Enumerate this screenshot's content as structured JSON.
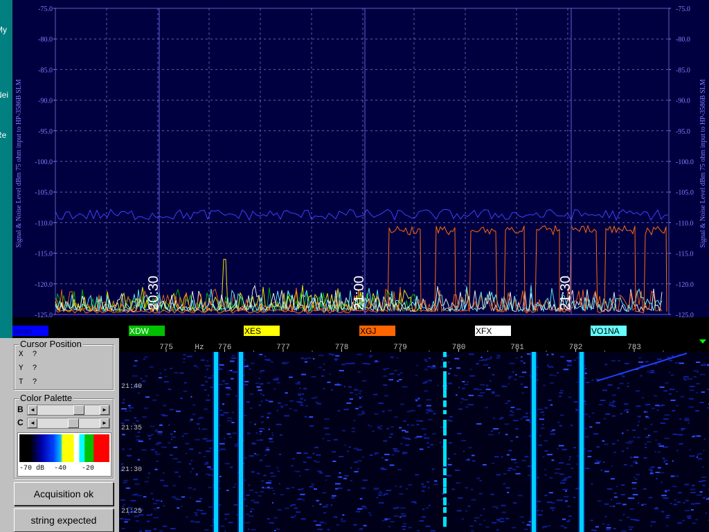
{
  "left_strip": {
    "labels": [
      "My",
      "Nei",
      "Re"
    ]
  },
  "spectrum": {
    "y_axis_title": "Signal & Noise Level dBm 75 ohm input to HP-3586B SLM",
    "y_ticks": [
      "-75.0",
      "-80.0",
      "-85.0",
      "-90.0",
      "-95.0",
      "-100.0",
      "-105.0",
      "-110.0",
      "-115.0",
      "-120.0",
      "-125.0"
    ],
    "time_markers": [
      "20:30",
      "21:00",
      "21:30"
    ],
    "legend": [
      {
        "label": "Ioran",
        "color": "#0000ff",
        "text_color": "#000080"
      },
      {
        "label": "XDW",
        "color": "#00c000",
        "text_color": "#ffffff"
      },
      {
        "label": "XES",
        "color": "#ffff00",
        "text_color": "#000000"
      },
      {
        "label": "XGJ",
        "color": "#ff6600",
        "text_color": "#000000"
      },
      {
        "label": "XFX",
        "color": "#ffffff",
        "text_color": "#000000"
      },
      {
        "label": "VO1NA",
        "color": "#66ffff",
        "text_color": "#000000"
      }
    ]
  },
  "waterfall": {
    "freq_labels": [
      "775",
      "776",
      "777",
      "778",
      "779",
      "780",
      "781",
      "782",
      "783"
    ],
    "freq_unit": "Hz",
    "time_labels": [
      "21:40",
      "21:35",
      "21:30",
      "21:25"
    ]
  },
  "cursor_position": {
    "title": "Cursor Position",
    "x_label": "X",
    "x_value": "?",
    "y_label": "Y",
    "y_value": "?",
    "t_label": "T",
    "t_value": "?"
  },
  "color_palette": {
    "title": "Color Palette",
    "b_label": "B",
    "c_label": "C",
    "scale_labels": [
      "-70 dB",
      "-40",
      "-20"
    ]
  },
  "buttons": {
    "acquisition": "Acquisition ok",
    "string": "string expected"
  }
}
